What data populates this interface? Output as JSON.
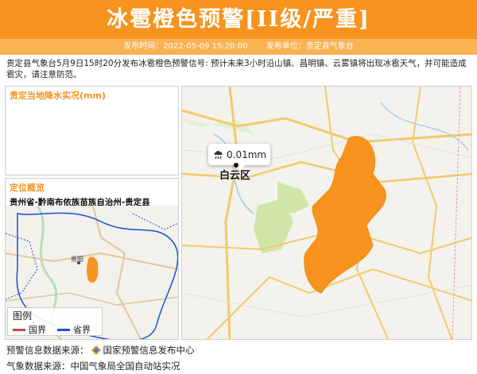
{
  "header": {
    "title": "冰雹橙色预警[II级/严重]",
    "publish_time": "发布时间：2022-05-09 15:20:00",
    "publisher": "发布单位：贵定县气象台"
  },
  "description": "贵定县气象台5月9日15时20分发布冰雹橙色预警信号: 预计未来3小时沿山镇、昌明镇、云雾镇将出现冰雹天气，并可能造成雹灾，请注意防范。",
  "precip_panel": {
    "title": "贵定当地降水实况(mm)"
  },
  "location_panel": {
    "title": "定位概览",
    "region": "贵州省-黔南布依族苗族自治州-贵定县",
    "city_label": "贵阳"
  },
  "legend": {
    "title": "图例",
    "items": [
      {
        "label": "国界",
        "color": "#c8464a"
      },
      {
        "label": "省界",
        "color": "#1f4fd6"
      }
    ]
  },
  "main_map": {
    "rain_value": "0.01mm",
    "place_name": "白云区",
    "warning_color": "#f7931e"
  },
  "footer": {
    "warning_source": "预警信息数据来源：",
    "warning_source_name": "国家预警信息发布中心",
    "weather_source": "气象数据来源：中国气象局全国自动站实况"
  }
}
